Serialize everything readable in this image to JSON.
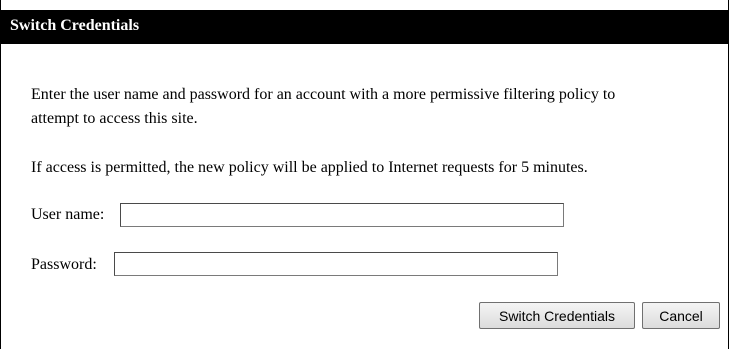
{
  "dialog": {
    "title": "Switch Credentials",
    "message_line_1": "Enter the user name and password for an account with a more permissive filtering policy to",
    "message_line_2": "attempt to access this site.",
    "message_line_3": "If access is permitted, the new policy will be applied to Internet requests for 5 minutes.",
    "username_label": "User name:",
    "username_value": "",
    "password_label": "Password:",
    "password_value": "",
    "switch_button_label": "Switch Credentials",
    "cancel_button_label": "Cancel"
  }
}
